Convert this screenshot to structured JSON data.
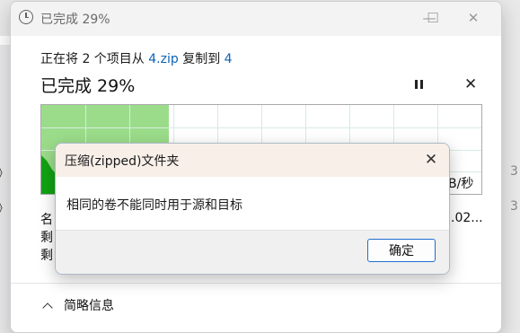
{
  "window": {
    "title": "已完成 29%",
    "minimize_glyph": "—",
    "maximize_glyph": "☐",
    "close_glyph": "✕"
  },
  "progress": {
    "copy_prefix": "正在将 2 个项目从",
    "source": "4.zip",
    "middle": "复制到",
    "destination": "4",
    "percent_label": "已完成 29%",
    "percent": 29,
    "close_glyph": "✕",
    "speed_label": "B/秒",
    "detail_name": "名",
    "detail_remaining1": "剩",
    "detail_remaining2": "剩",
    "detail_value_right": ".02...",
    "brief_label": "简略信息"
  },
  "dialog": {
    "title": "压缩(zipped)文件夹",
    "message": "相同的卷不能同时用于源和目标",
    "ok_label": "确定",
    "close_glyph": "✕"
  },
  "background": {
    "left_fragment_1": "》",
    "left_fragment_2": "》",
    "right_fragment_1": "3",
    "right_fragment_2": "3"
  },
  "colors": {
    "graph_fill": "#9bdc8a",
    "graph_grid": "#d6ece0",
    "accent": "#1f6fd0"
  },
  "icons": {
    "titlebar": "clock-icon",
    "pause": "pause-icon",
    "expand": "chevron-up-icon"
  }
}
